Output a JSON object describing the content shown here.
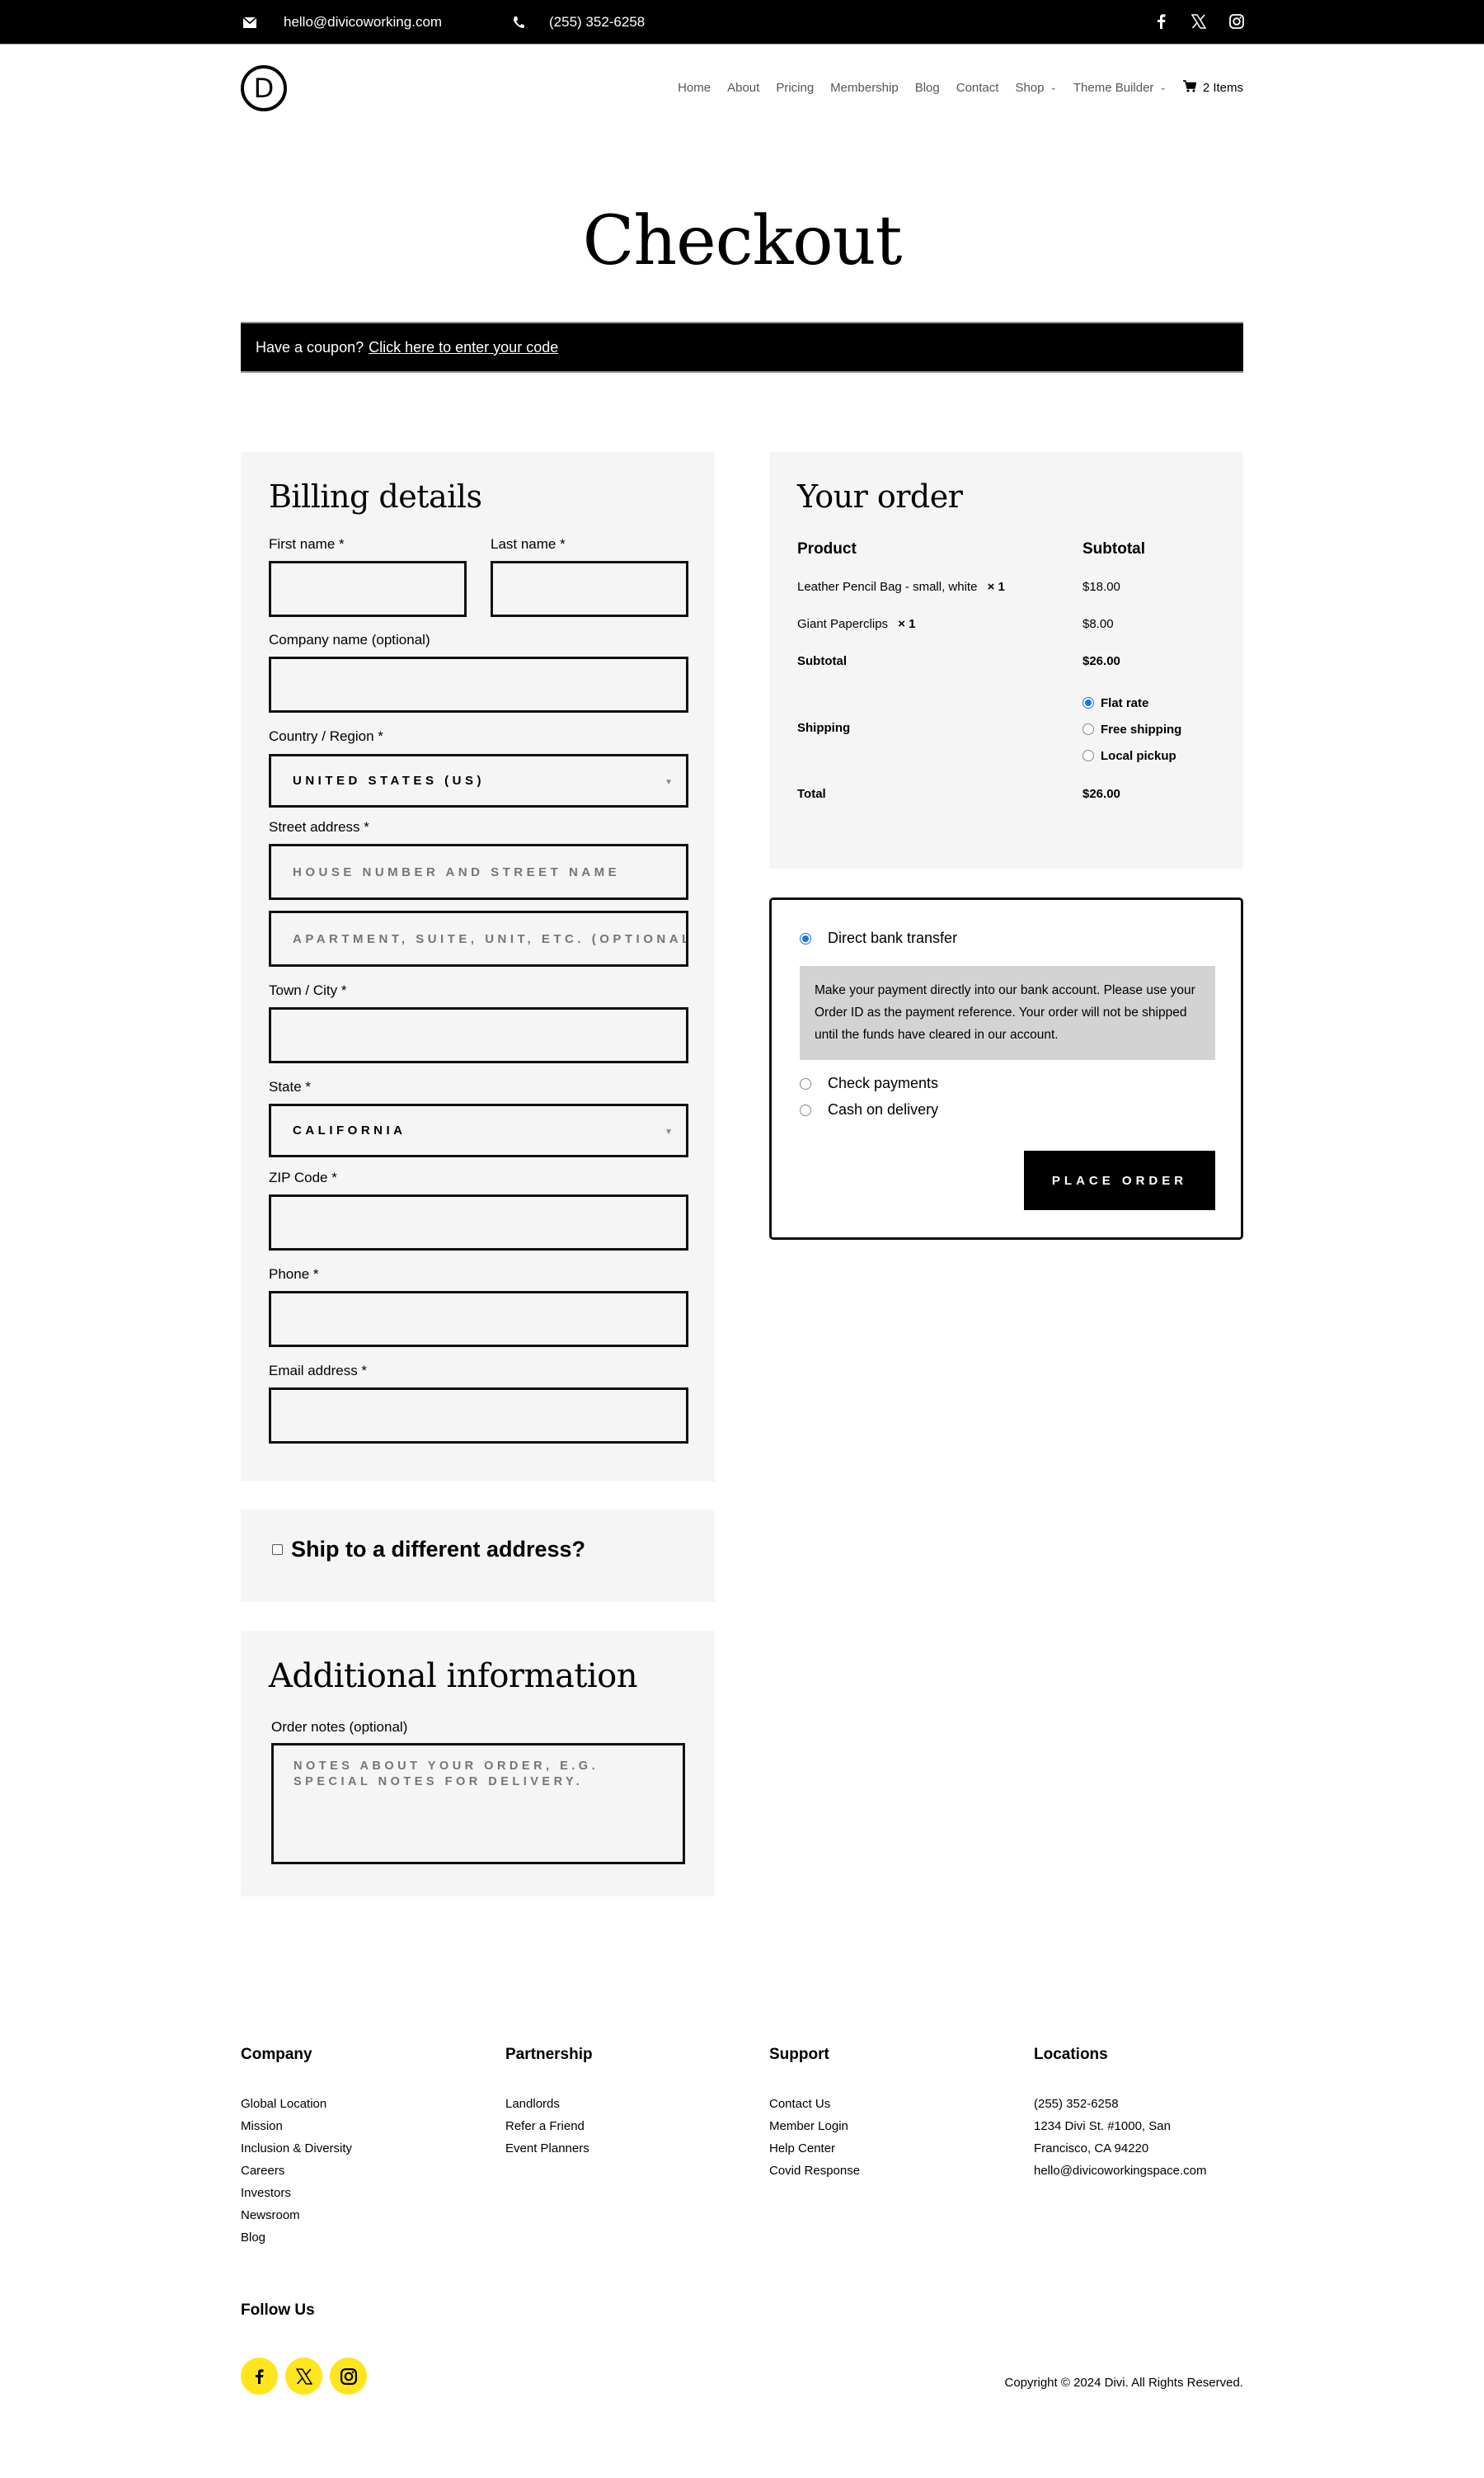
{
  "topbar": {
    "email": "hello@divicoworking.com",
    "phone": "(255) 352-6258",
    "email_icon": "envelope-icon",
    "phone_icon": "phone-icon",
    "social": [
      "facebook-icon",
      "x-icon",
      "instagram-icon"
    ]
  },
  "header": {
    "logo_letter": "D",
    "nav": [
      {
        "label": "Home"
      },
      {
        "label": "About"
      },
      {
        "label": "Pricing"
      },
      {
        "label": "Membership"
      },
      {
        "label": "Blog"
      },
      {
        "label": "Contact"
      },
      {
        "label": "Shop",
        "dropdown": true
      },
      {
        "label": "Theme Builder",
        "dropdown": true
      }
    ],
    "cart_label": "2 Items"
  },
  "page": {
    "title": "Checkout",
    "coupon_text": "Have a coupon?",
    "coupon_link": "Click here to enter your code"
  },
  "billing": {
    "title": "Billing details",
    "first_name_label": "First name *",
    "last_name_label": "Last name *",
    "company_label": "Company name (optional)",
    "country_label": "Country / Region *",
    "country_value": "United States (US)",
    "street_label": "Street address *",
    "street_placeholder": "House number and street name",
    "street2_placeholder": "Apartment, suite, unit, etc. (optional)",
    "city_label": "Town / City *",
    "state_label": "State *",
    "state_value": "California",
    "zip_label": "ZIP Code *",
    "phone_label": "Phone *",
    "email_label": "Email address *"
  },
  "shipping": {
    "ship_different_label": "Ship to a different address?",
    "checked": false
  },
  "additional": {
    "title": "Additional information",
    "notes_label": "Order notes (optional)",
    "notes_placeholder": "Notes about your order, e.g. special notes for delivery."
  },
  "order": {
    "title": "Your order",
    "col_product": "Product",
    "col_subtotal": "Subtotal",
    "items": [
      {
        "name": "Leather Pencil Bag - small, white",
        "qty": "× 1",
        "price": "$18.00"
      },
      {
        "name": "Giant Paperclips",
        "qty": "× 1",
        "price": "$8.00"
      }
    ],
    "subtotal_label": "Subtotal",
    "subtotal_value": "$26.00",
    "shipping_label": "Shipping",
    "shipping_options": [
      {
        "label": "Flat rate",
        "selected": true
      },
      {
        "label": "Free shipping",
        "selected": false
      },
      {
        "label": "Local pickup",
        "selected": false
      }
    ],
    "total_label": "Total",
    "total_value": "$26.00"
  },
  "payment": {
    "methods": [
      {
        "label": "Direct bank transfer",
        "selected": true
      },
      {
        "label": "Check payments",
        "selected": false
      },
      {
        "label": "Cash on delivery",
        "selected": false
      }
    ],
    "description": "Make your payment directly into our bank account. Please use your Order ID as the payment reference. Your order will not be shipped until the funds have cleared in our account.",
    "place_order_label": "Place Order"
  },
  "footer": {
    "columns": [
      {
        "title": "Company",
        "links": [
          "Global Location",
          "Mission",
          "Inclusion & Diversity",
          "Careers",
          "Investors",
          "Newsroom",
          "Blog"
        ]
      },
      {
        "title": "Partnership",
        "links": [
          "Landlords",
          "Refer a Friend",
          "Event Planners"
        ]
      },
      {
        "title": "Support",
        "links": [
          "Contact Us",
          "Member Login",
          "Help Center",
          "Covid Response"
        ]
      },
      {
        "title": "Locations",
        "lines": [
          "(255) 352-6258",
          "1234 Divi St. #1000, San",
          "Francisco, CA 94220",
          "hello@divicoworkingspace.com"
        ]
      }
    ],
    "follow_title": "Follow Us",
    "social": [
      "facebook-icon",
      "x-icon",
      "instagram-icon"
    ],
    "social_color": "#ffe51e",
    "copyright": "Copyright © 2024 Divi. All Rights Reserved."
  },
  "colors": {
    "accent_radio": "#1a73e8",
    "panel_bg": "#f5f5f5",
    "topbar_bg": "#000000"
  }
}
